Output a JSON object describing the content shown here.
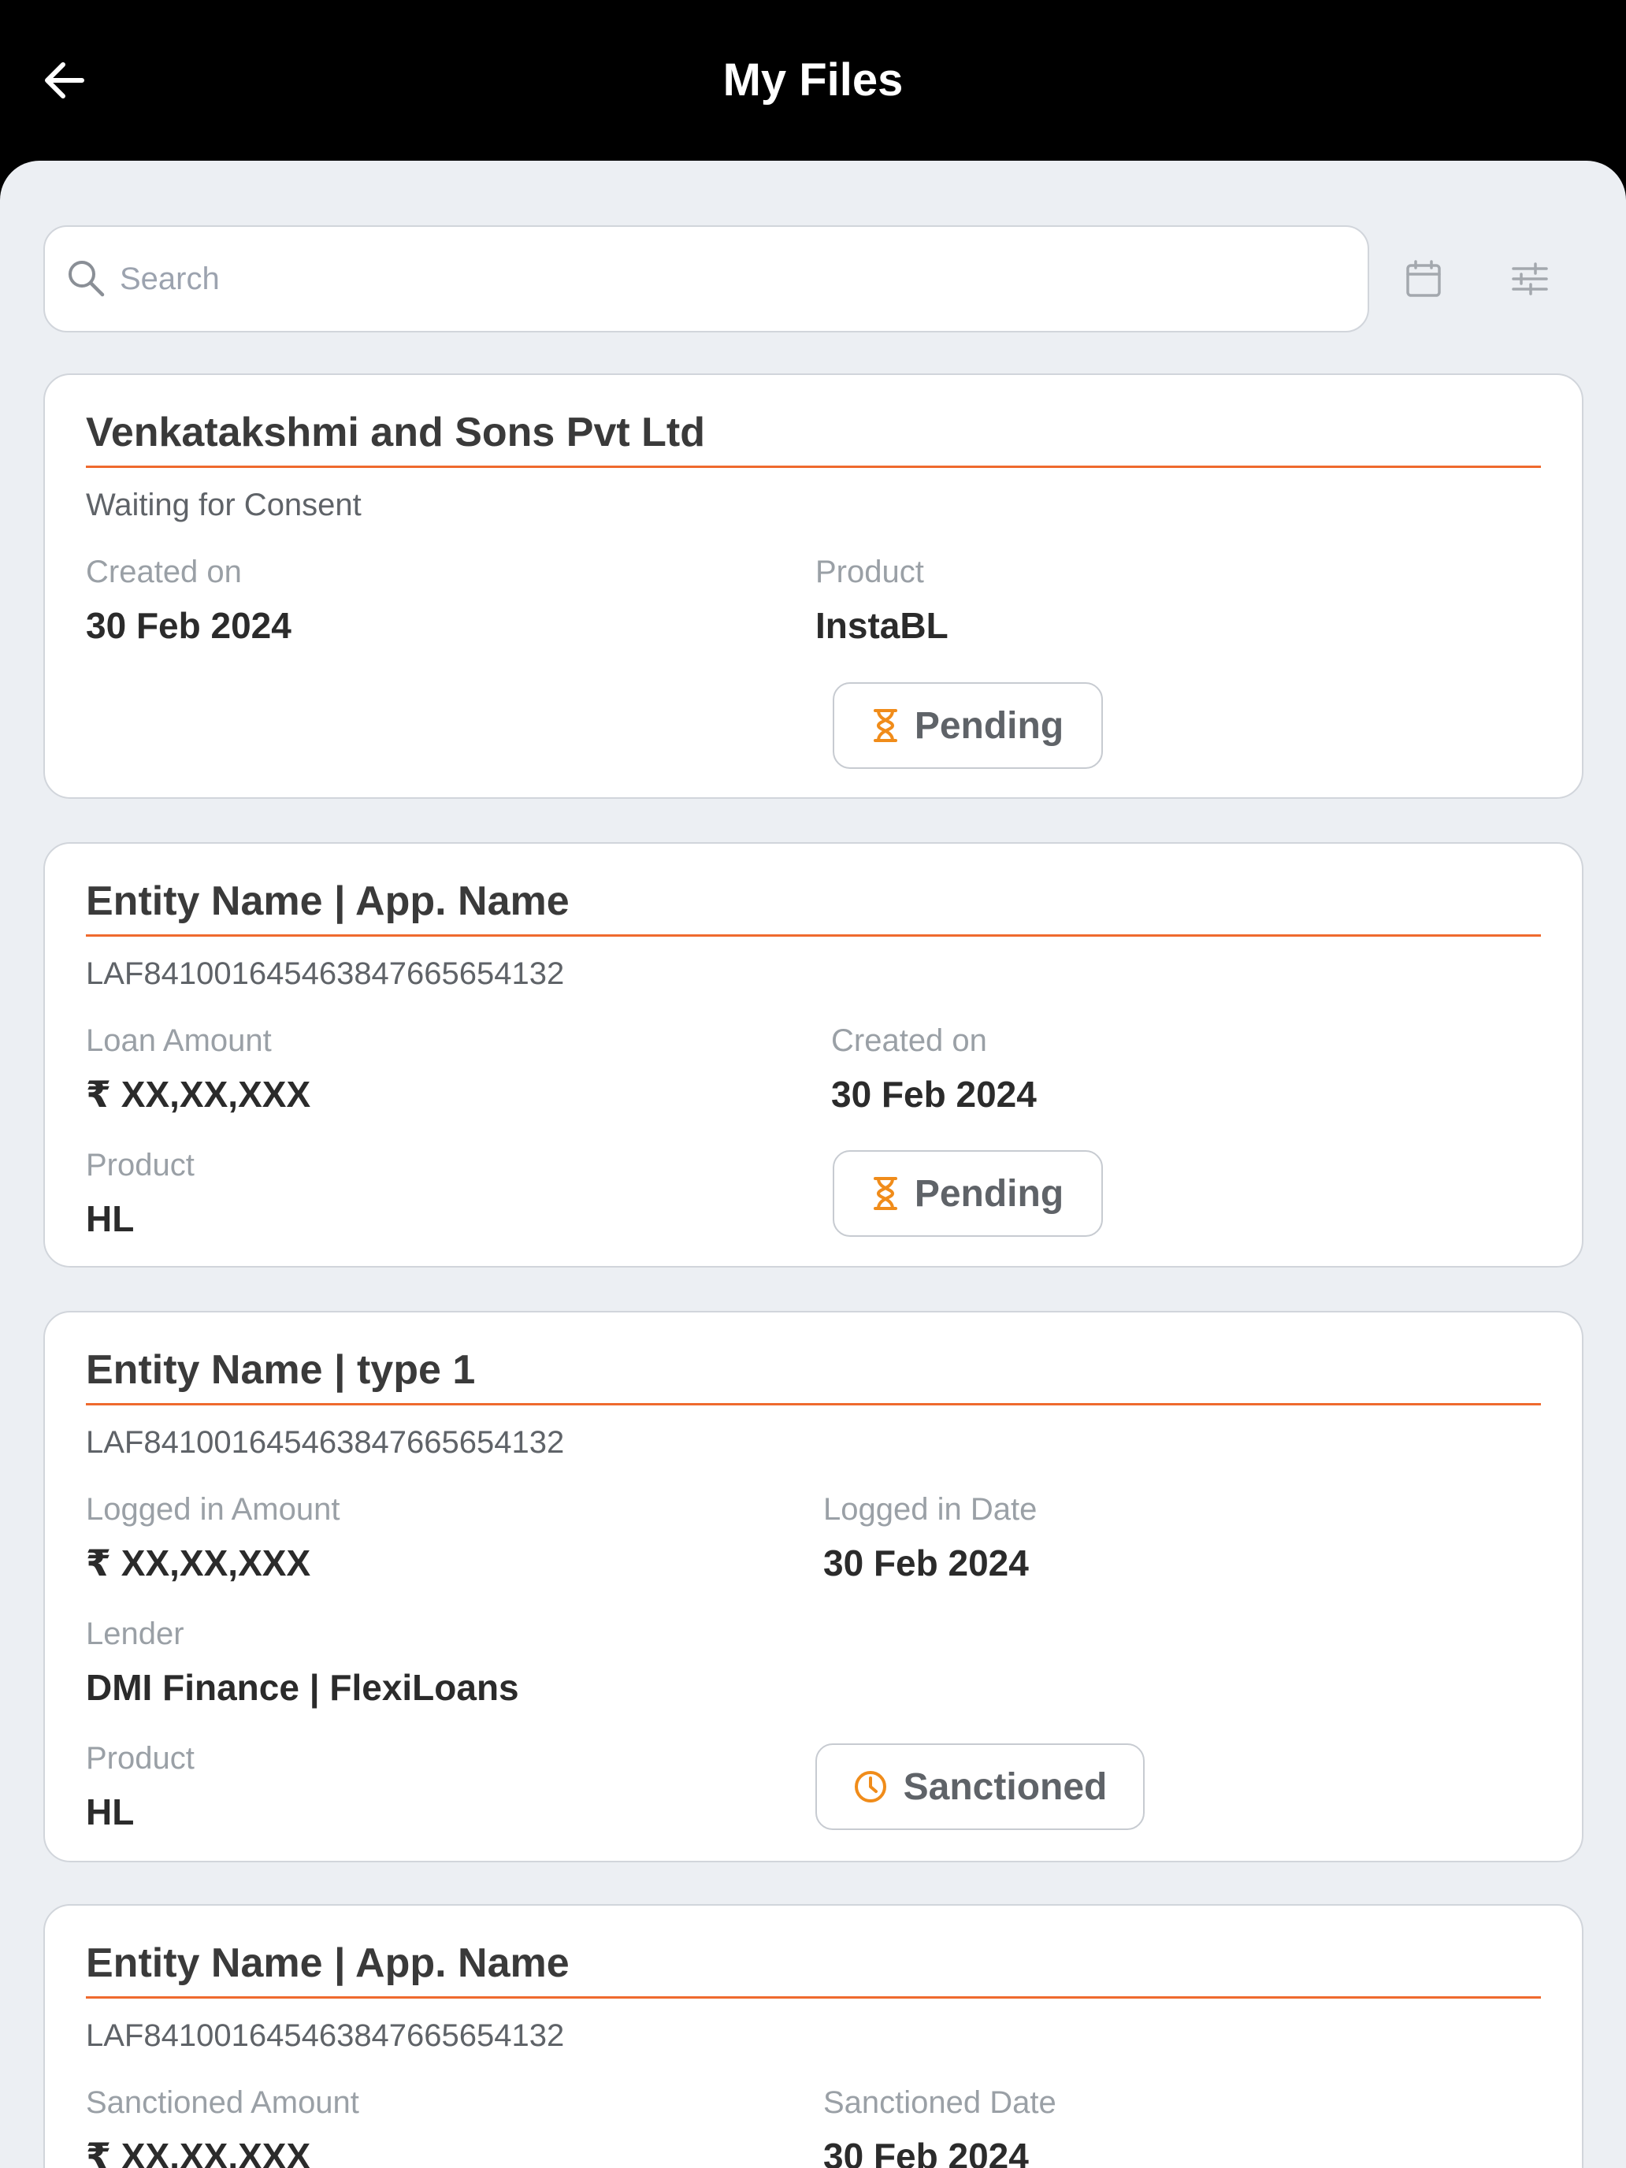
{
  "header": {
    "title": "My Files"
  },
  "search": {
    "placeholder": "Search"
  },
  "colors": {
    "accent": "#ef6a2e",
    "pending": "#f08c1a",
    "sanctioned": "#f08c1a"
  },
  "cards": [
    {
      "title": "Venkatakshmi and Sons Pvt Ltd",
      "subtitle": "Waiting for Consent",
      "fields": [
        {
          "label": "Created on",
          "value": "30 Feb 2024"
        },
        {
          "label": "Product",
          "value": "InstaBL"
        }
      ],
      "status": {
        "label": "Pending",
        "icon": "hourglass-icon"
      }
    },
    {
      "title": "Entity Name | App. Name",
      "subtitle": "LAF841001645463847665654132",
      "fields": [
        {
          "label": "Loan Amount",
          "value": "₹ XX,XX,XXX"
        },
        {
          "label": "Created on",
          "value": "30 Feb 2024"
        },
        {
          "label": "Product",
          "value": "HL"
        }
      ],
      "status": {
        "label": "Pending",
        "icon": "hourglass-icon"
      }
    },
    {
      "title": "Entity Name | type 1",
      "subtitle": "LAF841001645463847665654132",
      "fields": [
        {
          "label": "Logged in Amount",
          "value": "₹ XX,XX,XXX"
        },
        {
          "label": "Logged in Date",
          "value": "30 Feb 2024"
        },
        {
          "label": "Lender",
          "value": "DMI Finance | FlexiLoans"
        },
        {
          "label": "Product",
          "value": "HL"
        }
      ],
      "status": {
        "label": "Sanctioned",
        "icon": "clock-icon"
      }
    },
    {
      "title": "Entity Name | App. Name",
      "subtitle": "LAF841001645463847665654132",
      "fields": [
        {
          "label": "Sanctioned Amount",
          "value": "₹ XX,XX,XXX"
        },
        {
          "label": "Sanctioned Date",
          "value": "30 Feb 2024"
        }
      ]
    }
  ]
}
